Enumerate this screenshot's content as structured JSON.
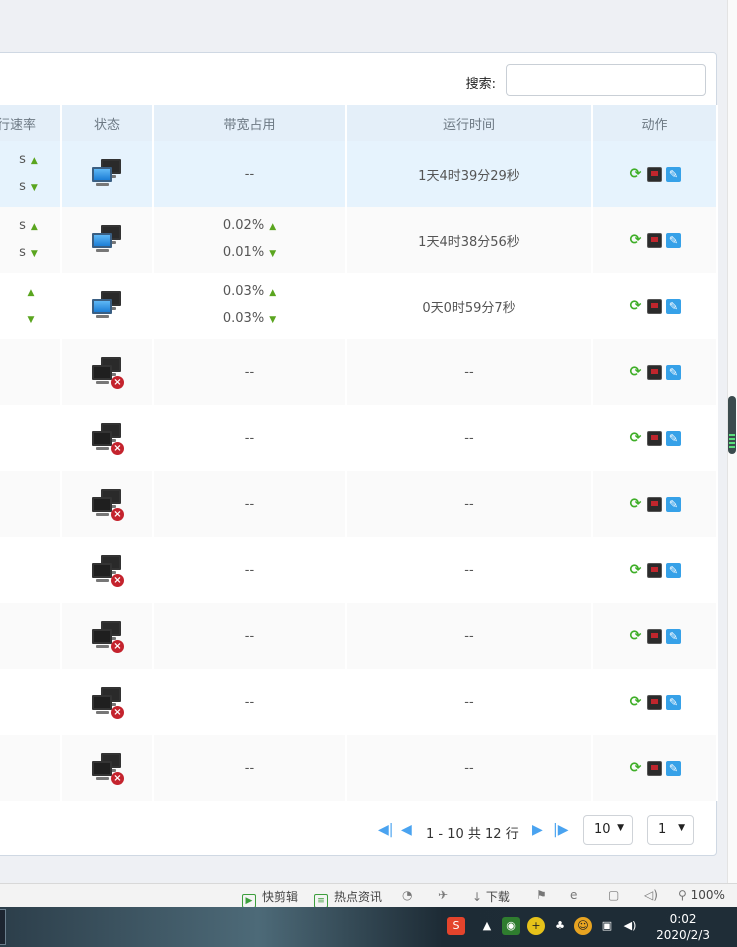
{
  "search": {
    "label": "搜索:",
    "value": "",
    "placeholder": ""
  },
  "table": {
    "headers": [
      "行速率",
      "状态",
      "带宽占用",
      "运行时间",
      "动作"
    ],
    "rows": [
      {
        "speed_up": "s",
        "speed_down": "s",
        "online": true,
        "bw_up": "",
        "bw_down": "",
        "bw_text": "--",
        "uptime": "1天4时39分29秒",
        "active": true
      },
      {
        "speed_up": "s",
        "speed_down": "s",
        "online": true,
        "bw_up": "0.02%",
        "bw_down": "0.01%",
        "bw_text": "",
        "uptime": "1天4时38分56秒",
        "active": false
      },
      {
        "speed_up": "",
        "speed_down": "",
        "online": true,
        "bw_up": "0.03%",
        "bw_down": "0.03%",
        "bw_text": "",
        "uptime": "0天0时59分7秒",
        "active": false
      },
      {
        "speed_up": "",
        "speed_down": "",
        "online": false,
        "bw_up": "",
        "bw_down": "",
        "bw_text": "--",
        "uptime": "--",
        "active": false
      },
      {
        "speed_up": "",
        "speed_down": "",
        "online": false,
        "bw_up": "",
        "bw_down": "",
        "bw_text": "--",
        "uptime": "--",
        "active": false
      },
      {
        "speed_up": "",
        "speed_down": "",
        "online": false,
        "bw_up": "",
        "bw_down": "",
        "bw_text": "--",
        "uptime": "--",
        "active": false
      },
      {
        "speed_up": "",
        "speed_down": "",
        "online": false,
        "bw_up": "",
        "bw_down": "",
        "bw_text": "--",
        "uptime": "--",
        "active": false
      },
      {
        "speed_up": "",
        "speed_down": "",
        "online": false,
        "bw_up": "",
        "bw_down": "",
        "bw_text": "--",
        "uptime": "--",
        "active": false
      },
      {
        "speed_up": "",
        "speed_down": "",
        "online": false,
        "bw_up": "",
        "bw_down": "",
        "bw_text": "--",
        "uptime": "--",
        "active": false
      },
      {
        "speed_up": "",
        "speed_down": "",
        "online": false,
        "bw_up": "",
        "bw_down": "",
        "bw_text": "--",
        "uptime": "--",
        "active": false
      }
    ]
  },
  "pager": {
    "info": "1 - 10 共 12 行",
    "page_size": "10",
    "page": "1"
  },
  "browser_status": {
    "items": [
      "快剪辑",
      "热点资讯",
      "下载"
    ],
    "zoom": "100%"
  },
  "taskbar": {
    "time": "0:02",
    "date": "2020/2/3"
  },
  "colors": {
    "header_bg": "#e4eff9",
    "active_row": "#e6f3fd",
    "accent": "#4aa3f0",
    "arrow_green": "#5aa51f",
    "offline_red": "#c4232d"
  }
}
